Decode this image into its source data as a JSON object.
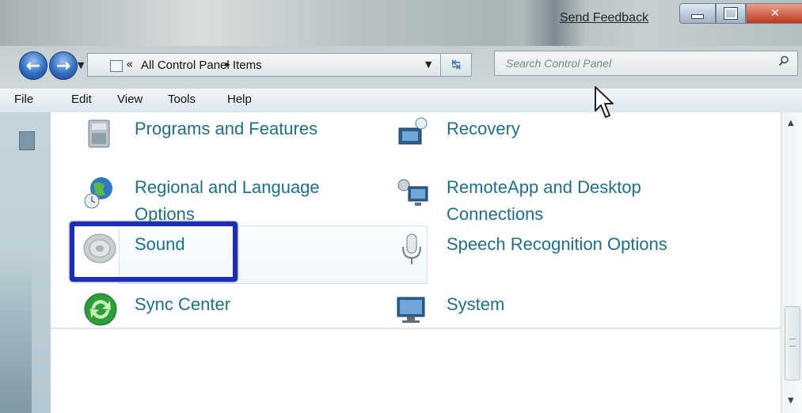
{
  "window": {
    "send_feedback": "Send Feedback"
  },
  "nav": {
    "address_chevron": "«",
    "address_path": "All Control Panel Items",
    "address_arrow": "▸",
    "search_placeholder": "Search Control Panel"
  },
  "menu": {
    "items": [
      "File",
      "Edit",
      "View",
      "Tools",
      "Help"
    ]
  },
  "items": {
    "programs": "Programs and Features",
    "recovery": "Recovery",
    "regional": "Regional and Language Options",
    "remoteapp": "RemoteApp and Desktop Connections",
    "sound": "Sound",
    "speech": "Speech Recognition Options",
    "sync": "Sync Center",
    "system": "System"
  },
  "icons": {
    "programs": "programs-icon",
    "recovery": "recovery-icon",
    "regional": "globe-icon",
    "remoteapp": "remote-desktop-icon",
    "sound": "speaker-icon",
    "speech": "microphone-icon",
    "sync": "sync-icon",
    "system": "computer-icon"
  },
  "colors": {
    "link": "#1f6e8c",
    "highlight": "#1c2eb5",
    "close_button": "#c0381d"
  }
}
